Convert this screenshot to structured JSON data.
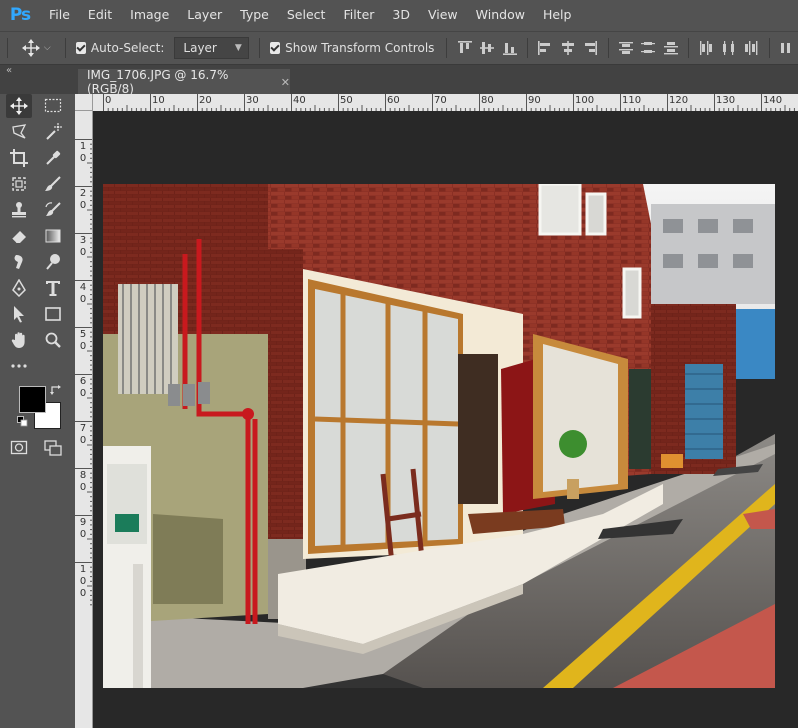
{
  "app": {
    "logo": "Ps"
  },
  "menu": [
    "File",
    "Edit",
    "Image",
    "Layer",
    "Type",
    "Select",
    "Filter",
    "3D",
    "View",
    "Window",
    "Help"
  ],
  "options": {
    "auto_select_label": "Auto-Select:",
    "auto_select_target": "Layer",
    "show_transform_label": "Show Transform Controls"
  },
  "document_tab": {
    "title": "IMG_1706.JPG @ 16.7% (RGB/8)"
  },
  "ruler_top_labels": [
    "0",
    "10",
    "20",
    "30",
    "40",
    "50",
    "60",
    "70",
    "80",
    "90",
    "100",
    "110",
    "120",
    "130",
    "140"
  ],
  "ruler_left_labels": [
    "1\n0",
    "2\n0",
    "3\n0",
    "4\n0",
    "5\n0",
    "6\n0",
    "7\n0",
    "8\n0",
    "9\n0",
    "1\n0\n0"
  ],
  "colors": {
    "foreground": "#000000",
    "background": "#ffffff",
    "accent": "#31a8ff"
  },
  "tools": [
    "move-tool",
    "marquee-tool",
    "lasso-tool",
    "magic-wand-tool",
    "crop-tool",
    "eyedropper-tool",
    "frame-tool",
    "brush-tool",
    "stamp-tool",
    "history-brush-tool",
    "eraser-tool",
    "gradient-tool",
    "smudge-tool",
    "dodge-tool",
    "pen-tool",
    "type-tool",
    "path-select-tool",
    "shape-tool",
    "hand-tool",
    "zoom-tool",
    "more-tools"
  ]
}
